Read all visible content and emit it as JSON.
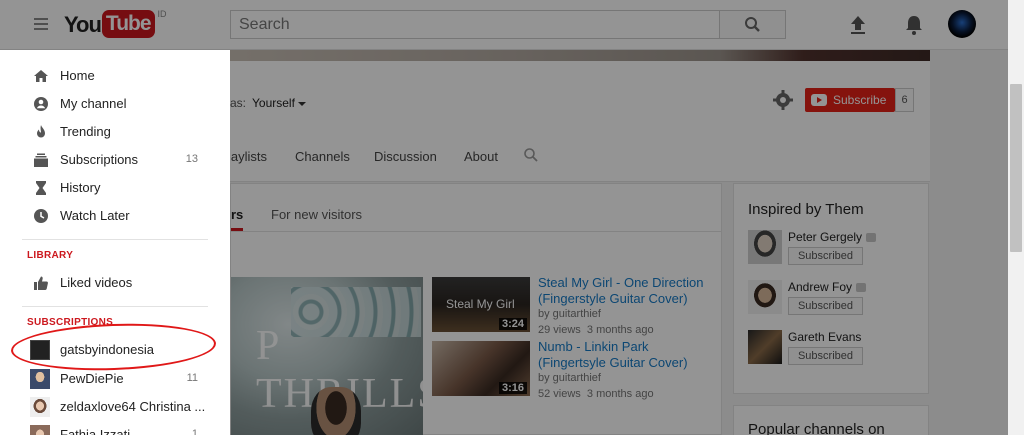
{
  "topbar": {
    "logo_you": "You",
    "logo_tube": "Tube",
    "country": "ID",
    "search_placeholder": "Search",
    "icons": [
      "menu-icon",
      "search-icon",
      "upload-icon",
      "bell-icon",
      "avatar"
    ]
  },
  "channel": {
    "view_as_label": "View as:",
    "view_as_value": "Yourself",
    "subscribe_label": "Subscribe",
    "subscriber_count": "6",
    "tabs": [
      "Playlists",
      "Channels",
      "Discussion",
      "About"
    ],
    "tab_fragment": "laylists"
  },
  "main": {
    "subtab_active": "For returning subscribers",
    "subtab_active_visible": "rs",
    "subtab_new": "For new visitors",
    "featured_text": "P THRILLS",
    "videos": [
      {
        "title_line1": "Steal My Girl - One Direction",
        "title_line2": "(Fingerstyle Guitar Cover)",
        "by": "by guitarthief",
        "views": "29 views",
        "age": "3 months ago",
        "duration": "3:24",
        "thumb_caption": "Steal My Girl"
      },
      {
        "title_line1": "Numb - Linkin Park",
        "title_line2": "(Fingertsyle Guitar Cover)",
        "by": "by guitarthief",
        "views": "52 views",
        "age": "3 months ago",
        "duration": "3:16",
        "thumb_caption": ""
      }
    ]
  },
  "side": {
    "inspired_title": "Inspired by Them",
    "recommended": [
      {
        "name": "Peter Gergely",
        "button": "Subscribed",
        "verified": true
      },
      {
        "name": "Andrew Foy",
        "button": "Subscribed",
        "verified": true
      },
      {
        "name": "Gareth Evans",
        "button": "Subscribed",
        "verified": false
      }
    ],
    "popular_title": "Popular channels on"
  },
  "guide": {
    "items": [
      {
        "label": "Home",
        "icon": "home-icon"
      },
      {
        "label": "My channel",
        "icon": "person-icon"
      },
      {
        "label": "Trending",
        "icon": "flame-icon"
      },
      {
        "label": "Subscriptions",
        "icon": "subscriptions-icon",
        "count": "13"
      },
      {
        "label": "History",
        "icon": "hourglass-icon"
      },
      {
        "label": "Watch Later",
        "icon": "clock-icon"
      }
    ],
    "library_heading": "LIBRARY",
    "library_items": [
      {
        "label": "Liked videos",
        "icon": "thumbs-up-icon"
      }
    ],
    "subscriptions_heading": "SUBSCRIPTIONS",
    "subscriptions": [
      {
        "label": "gatsbyindonesia",
        "count": ""
      },
      {
        "label": "PewDiePie",
        "count": "11"
      },
      {
        "label": "zeldaxlove64 Christina ...",
        "count": ""
      },
      {
        "label": "Fathia Izzati",
        "count": "1"
      }
    ]
  },
  "colors": {
    "accent_red": "#cc181e",
    "link_blue": "#167ac6",
    "annotation_red": "#e01818"
  }
}
